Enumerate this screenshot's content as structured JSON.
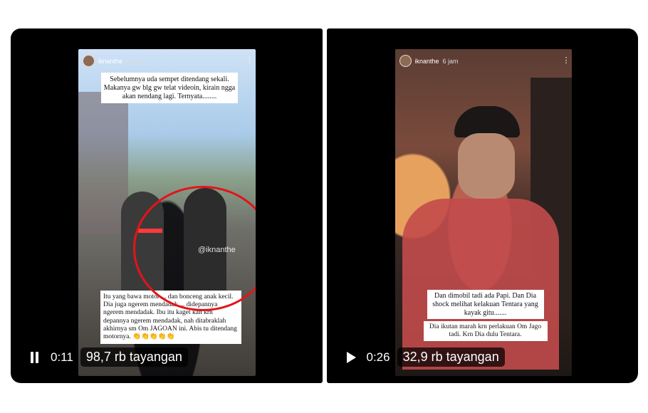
{
  "videos": [
    {
      "story_user": "iknanthe",
      "story_time": "6 jam",
      "caption_top": "Sebelumnya uda sempet ditendang sekali. Makanya gw blg gw telat videoin, kirain ngga akan nendang lagi. Ternyata........",
      "watermark": "@iknanthe",
      "caption_bottom": "Itu yang bawa motor ... dan bonceng anak kecil. Dia juga ngerem mendadak ... didepannya ngerem mendadak. Ibu itu kaget kan krn depannya ngerem mendadak, nah ditabraklah akhirnya sm Om JAGOAN ini. Abis tu ditendang motornya. 👏👏👏👏👏",
      "player_state": "pause",
      "elapsed": "0:11",
      "views": "98,7 rb tayangan"
    },
    {
      "story_user": "iknanthe",
      "story_time": "6 jam",
      "caption_top": "Dan dimobil tadi ada Papi. Dan Dia shock melihat kelakuan Tentara yang kayak gitu.......",
      "caption_bottom": "Dia ikutan marah krn perlakuan Om Jago tadi. Krn Dia dulu Tentara.",
      "player_state": "play",
      "elapsed": "0:26",
      "views": "32,9 rb tayangan"
    }
  ],
  "icons": {
    "pause": "pause-icon",
    "play": "play-icon",
    "more": "more-icon"
  },
  "colors": {
    "highlight_circle": "#e3141a"
  }
}
